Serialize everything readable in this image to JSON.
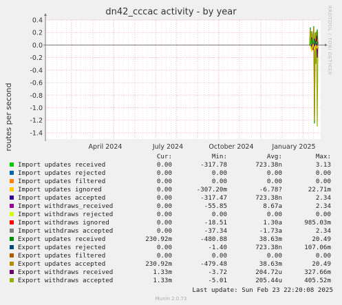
{
  "title": "dn42_cccac activity - by year",
  "ylabel": "routes per second",
  "watermark": "RRDTOOL / TOBI OETIKER",
  "headers": {
    "cur": "Cur:",
    "min": "Min:",
    "avg": "Avg:",
    "max": "Max:"
  },
  "last_update": "Last update: Sun Feb 23 22:20:08 2025",
  "version": "Munin 2.0.73",
  "chart_data": {
    "type": "line",
    "title": "dn42_cccac activity - by year",
    "ylabel": "routes per second",
    "ylim": [
      -1.5,
      0.4
    ],
    "yticks": [
      "0.4",
      "0.2",
      "0.0",
      "-0.2",
      "-0.4",
      "-0.6",
      "-0.8",
      "-1.0",
      "-1.2",
      "-1.4"
    ],
    "xticks": [
      "April 2024",
      "July 2024",
      "October 2024",
      "January 2025"
    ],
    "grid": true,
    "series": [
      {
        "name": "Import updates received",
        "color": "#00cc00",
        "cur": "0.00",
        "min": "-317.78",
        "avg": "723.38n",
        "max": "3.13"
      },
      {
        "name": "Import updates rejected",
        "color": "#0066b3",
        "cur": "0.00",
        "min": "0.00",
        "avg": "0.00",
        "max": "0.00"
      },
      {
        "name": "Import updates filtered",
        "color": "#ff8000",
        "cur": "0.00",
        "min": "0.00",
        "avg": "0.00",
        "max": "0.00"
      },
      {
        "name": "Import updates ignored",
        "color": "#ffcc00",
        "cur": "0.00",
        "min": "-307.20m",
        "avg": "-6.78?",
        "max": "22.71m"
      },
      {
        "name": "Import updates accepted",
        "color": "#330099",
        "cur": "0.00",
        "min": "-317.47",
        "avg": "723.38n",
        "max": "2.34"
      },
      {
        "name": "Import withdraws_received",
        "color": "#990099",
        "cur": "0.00",
        "min": "-55.85",
        "avg": "8.67a",
        "max": "2.34"
      },
      {
        "name": "Import withdraws rejected",
        "color": "#ccff00",
        "cur": "0.00",
        "min": "0.00",
        "avg": "0.00",
        "max": "0.00"
      },
      {
        "name": "Import withdraws ignored",
        "color": "#ff0000",
        "cur": "0.00",
        "min": "-18.51",
        "avg": "1.30a",
        "max": "985.03m"
      },
      {
        "name": "Import withdraws accepted",
        "color": "#808080",
        "cur": "0.00",
        "min": "-37.34",
        "avg": "-1.73a",
        "max": "2.34"
      },
      {
        "name": "Export updates received",
        "color": "#008f00",
        "cur": "230.92m",
        "min": "-480.88",
        "avg": "38.63m",
        "max": "20.49"
      },
      {
        "name": "Export updates rejected",
        "color": "#00487d",
        "cur": "0.00",
        "min": "-1.40",
        "avg": "723.38n",
        "max": "107.06m"
      },
      {
        "name": "Export updates filtered",
        "color": "#b35a00",
        "cur": "0.00",
        "min": "0.00",
        "avg": "0.00",
        "max": "0.00"
      },
      {
        "name": "Export updates accepted",
        "color": "#b38f00",
        "cur": "230.92m",
        "min": "-479.48",
        "avg": "38.63m",
        "max": "20.49"
      },
      {
        "name": "Export withdraws received",
        "color": "#6b006b",
        "cur": "1.33m",
        "min": "-3.72",
        "avg": "204.72u",
        "max": "327.66m"
      },
      {
        "name": "Export withdraws accepted",
        "color": "#8fb300",
        "cur": "1.33m",
        "min": "-5.01",
        "avg": "205.44u",
        "max": "405.52m"
      }
    ]
  }
}
